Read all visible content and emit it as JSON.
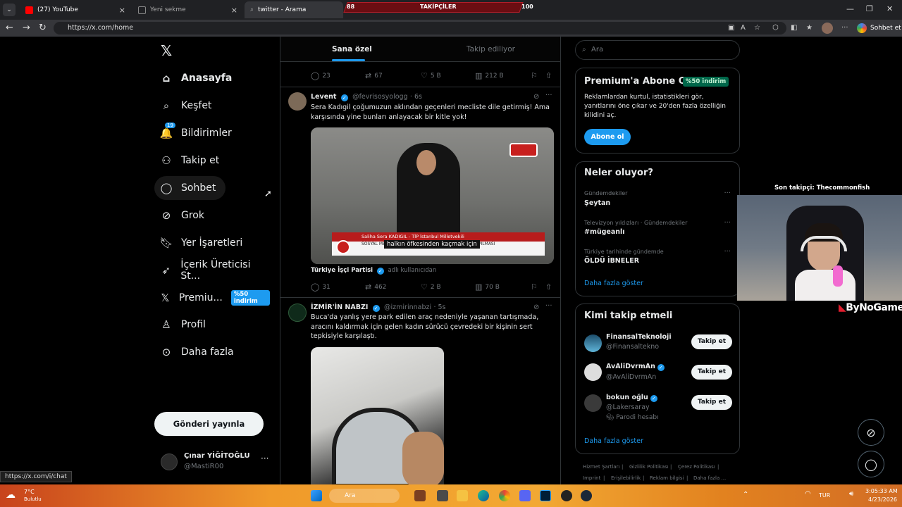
{
  "browser": {
    "tabs": [
      {
        "title": "(27) YouTube"
      },
      {
        "title": "Yeni sekme"
      },
      {
        "title": "twitter - Arama"
      }
    ],
    "url": "https://x.com/home",
    "profile_button": "Sohbet et",
    "status_url": "https://x.com/i/chat"
  },
  "stream_overlay": {
    "left_count": "88",
    "label": "TAKİPÇİLER",
    "right_count": "100",
    "last_follower": "Son takipçi: Thecommonfish",
    "brand": "ByNoGame"
  },
  "nav": {
    "items": [
      {
        "label": "Anasayfa",
        "icon": "home-icon"
      },
      {
        "label": "Keşfet",
        "icon": "search-icon"
      },
      {
        "label": "Bildirimler",
        "icon": "bell-icon",
        "badge": "19"
      },
      {
        "label": "Takip et",
        "icon": "add-person-icon"
      },
      {
        "label": "Sohbet",
        "icon": "chat-icon"
      },
      {
        "label": "Grok",
        "icon": "grok-icon"
      },
      {
        "label": "Yer İşaretleri",
        "icon": "bookmark-icon"
      },
      {
        "label": "İçerik Üreticisi St...",
        "icon": "rocket-icon"
      },
      {
        "label": "Premiu...",
        "icon": "x-logo-icon",
        "badge": "%50 indirim"
      },
      {
        "label": "Profil",
        "icon": "person-icon"
      },
      {
        "label": "Daha fazla",
        "icon": "more-circle-icon"
      }
    ],
    "post_button": "Gönderi yayınla",
    "account": {
      "name": "Çınar YİĞİTOĞLU",
      "handle": "@MastiR00"
    }
  },
  "feed": {
    "tabs": [
      "Sana özel",
      "Takip ediliyor"
    ],
    "top_actions": {
      "replies": "23",
      "reposts": "67",
      "likes": "5 B",
      "views": "212 B"
    },
    "tweets": [
      {
        "name": "Levent",
        "handle": "@fevrisosyologg",
        "time": "6s",
        "text": "Sera Kadıgil çoğumuzun aklından geçenleri mecliste dile getirmiş! Ama karşısında yine bunları anlayacak bir kitle yok!",
        "media_caption_title": "Saliha Sera KADIGIL - TİP İstanbul Milletvekili",
        "media_caption_line": "SOSYAL MEDYA DÜZENLEMESİNE İLİŞKİN DEĞİŞİKLİK YAPILMASI",
        "media_subtitle": "halkın öfkesinden kaçmak için",
        "media_source_name": "Türkiye İşçi Partisi",
        "media_source_suffix": "adlı kullanıcıdan",
        "replies": "31",
        "reposts": "462",
        "likes": "2 B",
        "views": "70 B"
      },
      {
        "name": "İZMİR'İN NABZI",
        "handle": "@izmirinnabzi",
        "time": "5s",
        "text": "Buca'da yanlış yere park edilen araç nedeniyle yaşanan tartışmada, aracını kaldırmak için gelen kadın sürücü çevredeki bir kişinin sert tepkisiyle karşılaştı."
      }
    ]
  },
  "sidebar": {
    "search_placeholder": "Ara",
    "premium": {
      "title": "Premium'a Abone Ol",
      "badge": "%50 indirim",
      "text": "Reklamlardan kurtul, istatistikleri gör, yanıtlarını öne çıkar ve 20'den fazla özelliğin kilidini aç.",
      "button": "Abone ol"
    },
    "trends": {
      "title": "Neler oluyor?",
      "items": [
        {
          "meta": "Gündemdekiler",
          "topic": "Şeytan"
        },
        {
          "meta": "Televizyon yıldızları · Gündemdekiler",
          "topic": "#mügeanlı"
        },
        {
          "meta": "Türkiye tarihinde gündemde",
          "topic": "ÖLDÜ İBNELER"
        }
      ],
      "show_more": "Daha fazla göster"
    },
    "who_to_follow": {
      "title": "Kimi takip etmeli",
      "items": [
        {
          "name": "FinansalTeknoloji",
          "handle": "@Finansaltekno",
          "verified": false,
          "note": ""
        },
        {
          "name": "AvAliDvrmAn",
          "handle": "@AvAliDvrmAn",
          "verified": true,
          "note": ""
        },
        {
          "name": "bokun oğlu",
          "handle": "@Lakersaray",
          "verified": true,
          "note": "Parodi hesabı"
        }
      ],
      "button": "Takip et",
      "show_more": "Daha fazla göster"
    },
    "footer_links": [
      "Hizmet Şartları",
      "Gizlilik Politikası",
      "Çerez Politikası",
      "Imprint",
      "Erişilebilirlik",
      "Reklam bilgisi",
      "Daha fazla ..."
    ]
  },
  "taskbar": {
    "weather_temp": "7°C",
    "weather_desc": "Bulutlu",
    "search_placeholder": "Ara",
    "lang": "TUR",
    "time": "3:05:33 AM",
    "date": "4/23/2026"
  }
}
